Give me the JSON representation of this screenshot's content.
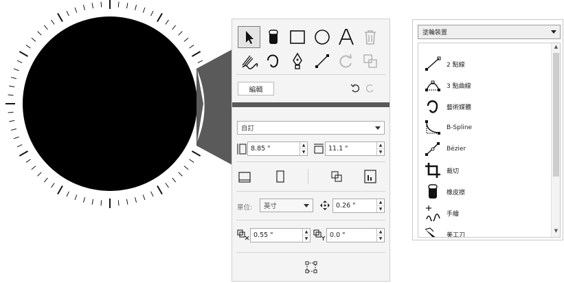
{
  "tools": [
    {
      "name": "pick-tool",
      "icon": "arrow-pointer-icon",
      "selected": true
    },
    {
      "name": "eraser-tool",
      "icon": "eraser-icon",
      "selected": false
    },
    {
      "name": "rectangle-tool",
      "icon": "rectangle-icon",
      "selected": false
    },
    {
      "name": "ellipse-tool",
      "icon": "ellipse-icon",
      "selected": false
    },
    {
      "name": "text-tool",
      "icon": "text-a-icon",
      "selected": false
    },
    {
      "name": "trash-tool",
      "icon": "trash-icon",
      "selected": false
    },
    {
      "name": "artistic-media-tool",
      "icon": "brush-stroke-icon",
      "selected": false
    },
    {
      "name": "fluid-curve-tool",
      "icon": "curve-icon",
      "selected": false
    },
    {
      "name": "pen-tool",
      "icon": "pen-nib-icon",
      "selected": false
    },
    {
      "name": "line-tool",
      "icon": "two-point-line-icon",
      "selected": false
    },
    {
      "name": "refresh-tool",
      "icon": "refresh-icon",
      "selected": false
    },
    {
      "name": "duplicate-tool",
      "icon": "overlap-squares-icon",
      "selected": false
    }
  ],
  "edit_label": "編輯",
  "page_size_select": "自訂",
  "width_value": "8.85 \"",
  "height_value": "11.1 \"",
  "units_label": "單位:",
  "units_value": "英寸",
  "nudge_value": "0.26 \"",
  "dup_x_value": "0.55 \"",
  "dup_y_value": "0.0 \"",
  "toolbox_select": "塗輪裝置",
  "list_items": [
    {
      "label": "2 點線",
      "icon": "two-point-line-icon"
    },
    {
      "label": "3 點曲線",
      "icon": "three-point-curve-icon"
    },
    {
      "label": "藝術媒體",
      "icon": "artistic-media-icon"
    },
    {
      "label": "B-Spline",
      "icon": "b-spline-icon"
    },
    {
      "label": "Bézier",
      "icon": "bezier-icon"
    },
    {
      "label": "裁切",
      "icon": "crop-icon"
    },
    {
      "label": "橡皮擦",
      "icon": "eraser-icon"
    },
    {
      "label": "手繪",
      "icon": "freehand-icon"
    },
    {
      "label": "美工刀",
      "icon": "knife-icon"
    }
  ],
  "colors": {
    "dial_fill": "#000000",
    "panel_bg": "#f4f4f4",
    "dark_bar": "#5a5a5a",
    "wedge": "#5a5a5a"
  }
}
